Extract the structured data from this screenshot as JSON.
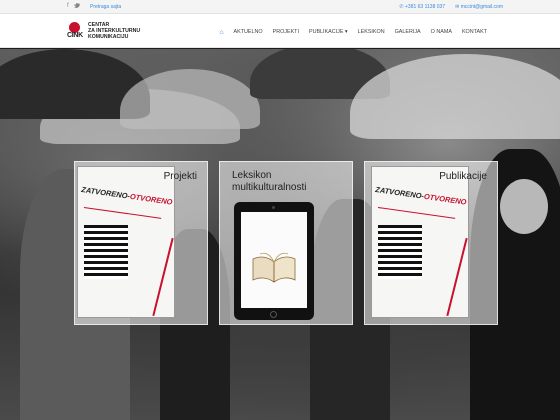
{
  "topbar": {
    "search_link": "Pretraga sajta",
    "phone": "+381 63 1138 037",
    "email": "mccint@gmail.com"
  },
  "logo": {
    "mark": "CINK",
    "line1": "CENTAR",
    "line2": "ZA INTERKULTURNU",
    "line3": "KOMUNIKACIJU"
  },
  "nav": {
    "items": [
      {
        "label": "AKTUELNO"
      },
      {
        "label": "PROJEKTI"
      },
      {
        "label": "PUBLIKACIJE ▾"
      },
      {
        "label": "LEKSIKON"
      },
      {
        "label": "GALERIJA"
      },
      {
        "label": "O NAMA"
      },
      {
        "label": "KONTAKT"
      }
    ]
  },
  "tiles": [
    {
      "title": "Projekti",
      "book_title_a": "ZATVORENO-",
      "book_title_b": "OTVORENO"
    },
    {
      "title_line1": "Leksikon",
      "title_line2": "multikulturalnosti"
    },
    {
      "title": "Publikacije",
      "book_title_a": "ZATVORENO-",
      "book_title_b": "OTVORENO"
    }
  ],
  "colors": {
    "accent": "#3a8bd8",
    "brand_red": "#c8102e"
  },
  "icons": [
    "facebook-icon",
    "twitter-icon",
    "phone-icon",
    "mail-icon",
    "home-icon"
  ]
}
